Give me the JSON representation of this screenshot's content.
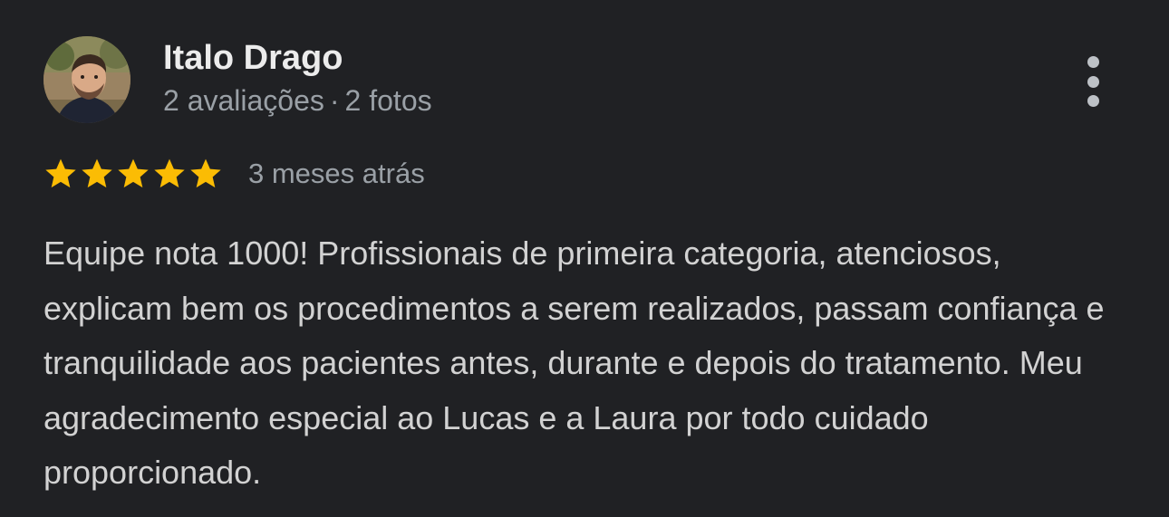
{
  "reviewer": {
    "name": "Italo Drago",
    "reviews_count": "2 avaliações",
    "separator": "·",
    "photos_count": "2 fotos"
  },
  "rating": {
    "stars": 5,
    "max_stars": 5,
    "star_color": "#fbbc04",
    "date": "3 meses atrás"
  },
  "review": {
    "text": "Equipe nota 1000! Profissionais de primeira categoria, atenciosos, explicam bem os procedimentos a serem realizados, passam confiança e tranquilidade aos pacientes antes, durante e depois do tratamento. Meu agradecimento especial ao Lucas e a Laura por todo cuidado proporcionado."
  },
  "icons": {
    "more": "more-vert-icon",
    "star": "star-icon"
  },
  "colors": {
    "background": "#202124",
    "name": "#ececec",
    "secondary": "#9aa0a6",
    "body": "#d2d2d2"
  }
}
